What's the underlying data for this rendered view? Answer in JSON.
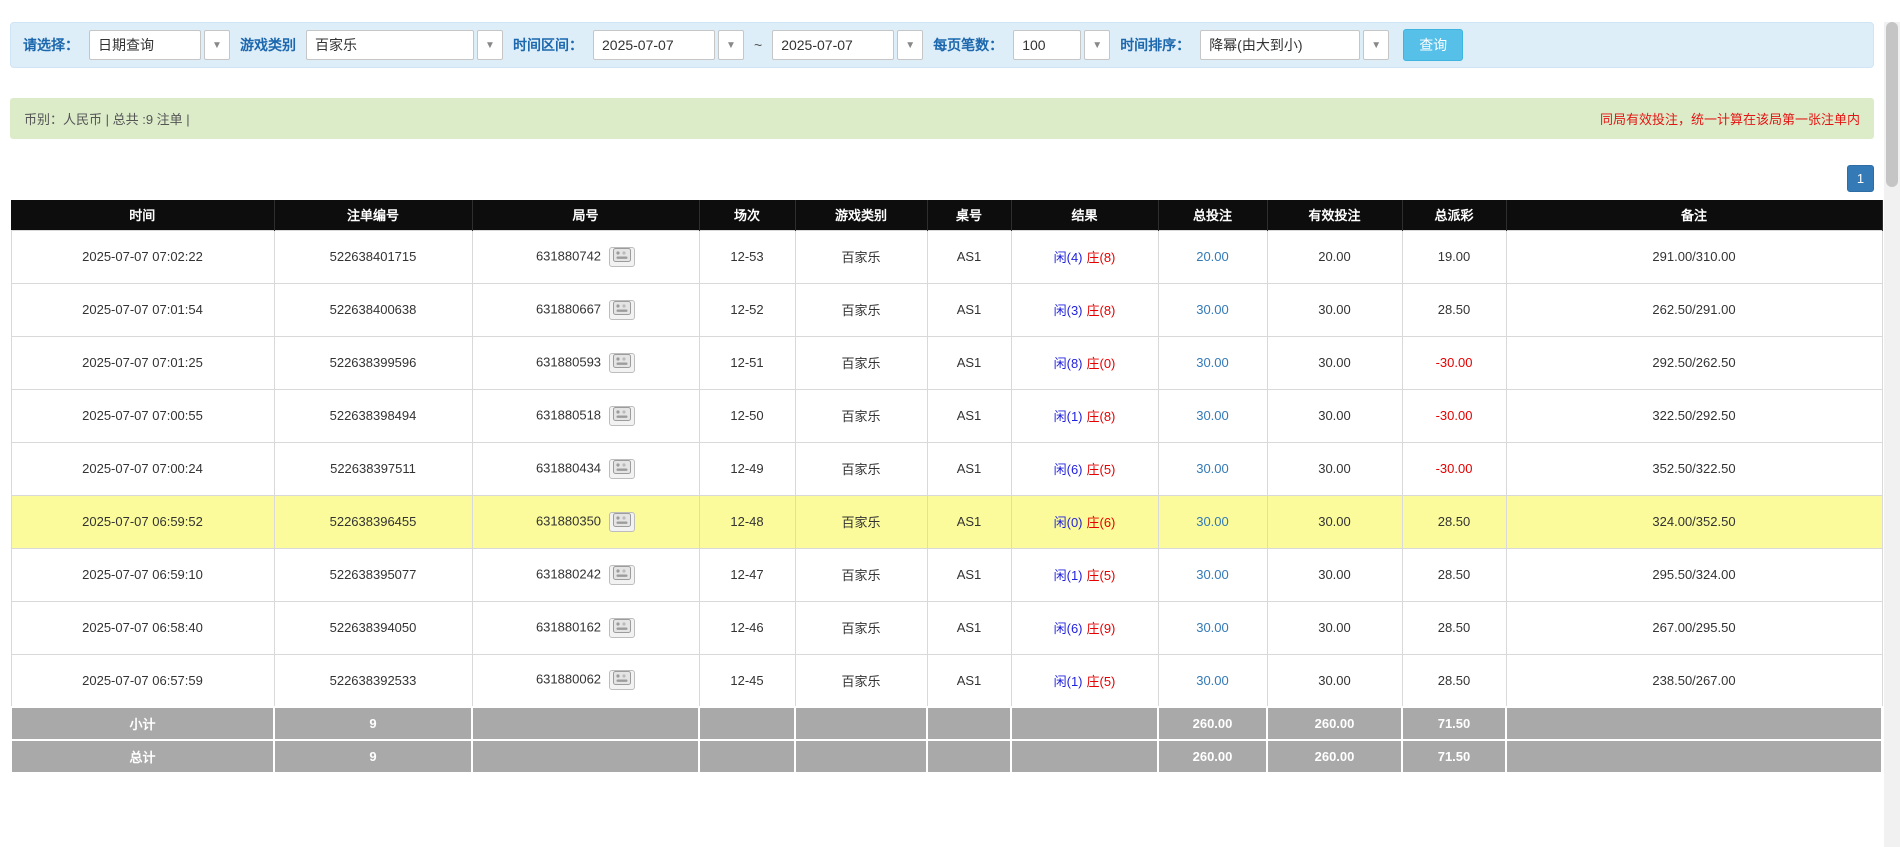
{
  "toolbar": {
    "select_label": "请选择：",
    "select_value": "日期查询",
    "game_label": "游戏类别",
    "game_value": "百家乐",
    "range_label": "时间区间：",
    "date_from": "2025-07-07",
    "range_separator": "~",
    "date_to": "2025-07-07",
    "per_page_label": "每页笔数：",
    "per_page_value": "100",
    "sort_label": "时间排序：",
    "sort_value": "降幂(由大到小)",
    "query_button": "查询"
  },
  "info_bar": {
    "summary": "币别：人民币 | 总共 :9 注单 |",
    "notice": "同局有效投注，统一计算在该局第一张注单内"
  },
  "pagination": {
    "page": "1"
  },
  "icons": {
    "combo_arrow": "chevron-down-icon ▾",
    "round_icon": "roadmap-icon (small gray board button next to round number)"
  },
  "colors": {
    "toolbar_blue": "#ddeef9",
    "label_blue": "#1c67ad",
    "query_button_blue": "#57c0e8",
    "infobar_green": "#dcecc9",
    "notice_red": "#e51414",
    "header_black": "#0d0d0d",
    "footer_gray": "#a9a9a9",
    "highlight_yellow": "#fbfb9b",
    "player_blue": "#2222dd",
    "banker_red": "#e60000",
    "link_blue": "#337ab7",
    "pagination_blue": "#337ab7"
  },
  "table": {
    "headers": [
      "时间",
      "注单编号",
      "局号",
      "场次",
      "游戏类别",
      "桌号",
      "结果",
      "总投注",
      "有效投注",
      "总派彩",
      "备注"
    ],
    "rows": [
      {
        "time": "2025-07-07 07:02:22",
        "bet_no": "522638401715",
        "round": "631880742",
        "session": "12-53",
        "game": "百家乐",
        "table_no": "AS1",
        "result_player": "闲(4)",
        "result_banker": "庄(8)",
        "total_bet": "20.00",
        "valid_bet": "20.00",
        "total_payout": "19.00",
        "remark": "291.00/310.00",
        "highlight": false
      },
      {
        "time": "2025-07-07 07:01:54",
        "bet_no": "522638400638",
        "round": "631880667",
        "session": "12-52",
        "game": "百家乐",
        "table_no": "AS1",
        "result_player": "闲(3)",
        "result_banker": "庄(8)",
        "total_bet": "30.00",
        "valid_bet": "30.00",
        "total_payout": "28.50",
        "remark": "262.50/291.00",
        "highlight": false
      },
      {
        "time": "2025-07-07 07:01:25",
        "bet_no": "522638399596",
        "round": "631880593",
        "session": "12-51",
        "game": "百家乐",
        "table_no": "AS1",
        "result_player": "闲(8)",
        "result_banker": "庄(0)",
        "total_bet": "30.00",
        "valid_bet": "30.00",
        "total_payout": "-30.00",
        "remark": "292.50/262.50",
        "highlight": false
      },
      {
        "time": "2025-07-07 07:00:55",
        "bet_no": "522638398494",
        "round": "631880518",
        "session": "12-50",
        "game": "百家乐",
        "table_no": "AS1",
        "result_player": "闲(1)",
        "result_banker": "庄(8)",
        "total_bet": "30.00",
        "valid_bet": "30.00",
        "total_payout": "-30.00",
        "remark": "322.50/292.50",
        "highlight": false
      },
      {
        "time": "2025-07-07 07:00:24",
        "bet_no": "522638397511",
        "round": "631880434",
        "session": "12-49",
        "game": "百家乐",
        "table_no": "AS1",
        "result_player": "闲(6)",
        "result_banker": "庄(5)",
        "total_bet": "30.00",
        "valid_bet": "30.00",
        "total_payout": "-30.00",
        "remark": "352.50/322.50",
        "highlight": false
      },
      {
        "time": "2025-07-07 06:59:52",
        "bet_no": "522638396455",
        "round": "631880350",
        "session": "12-48",
        "game": "百家乐",
        "table_no": "AS1",
        "result_player": "闲(0)",
        "result_banker": "庄(6)",
        "total_bet": "30.00",
        "valid_bet": "30.00",
        "total_payout": "28.50",
        "remark": "324.00/352.50",
        "highlight": true
      },
      {
        "time": "2025-07-07 06:59:10",
        "bet_no": "522638395077",
        "round": "631880242",
        "session": "12-47",
        "game": "百家乐",
        "table_no": "AS1",
        "result_player": "闲(1)",
        "result_banker": "庄(5)",
        "total_bet": "30.00",
        "valid_bet": "30.00",
        "total_payout": "28.50",
        "remark": "295.50/324.00",
        "highlight": false
      },
      {
        "time": "2025-07-07 06:58:40",
        "bet_no": "522638394050",
        "round": "631880162",
        "session": "12-46",
        "game": "百家乐",
        "table_no": "AS1",
        "result_player": "闲(6)",
        "result_banker": "庄(9)",
        "total_bet": "30.00",
        "valid_bet": "30.00",
        "total_payout": "28.50",
        "remark": "267.00/295.50",
        "highlight": false
      },
      {
        "time": "2025-07-07 06:57:59",
        "bet_no": "522638392533",
        "round": "631880062",
        "session": "12-45",
        "game": "百家乐",
        "table_no": "AS1",
        "result_player": "闲(1)",
        "result_banker": "庄(5)",
        "total_bet": "30.00",
        "valid_bet": "30.00",
        "total_payout": "28.50",
        "remark": "238.50/267.00",
        "highlight": false
      }
    ],
    "footer": {
      "subtotal": {
        "label": "小计",
        "count": "9",
        "total_bet": "260.00",
        "valid_bet": "260.00",
        "total_payout": "71.50"
      },
      "total": {
        "label": "总计",
        "count": "9",
        "total_bet": "260.00",
        "valid_bet": "260.00",
        "total_payout": "71.50"
      }
    }
  }
}
